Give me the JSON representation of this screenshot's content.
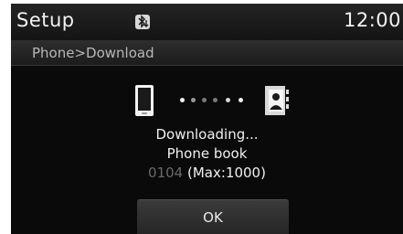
{
  "header": {
    "title": "Setup",
    "bluetooth_icon": "bluetooth-download-icon",
    "clock": "12:00"
  },
  "breadcrumb": "Phone>Download",
  "transfer": {
    "source_icon": "phone-icon",
    "target_icon": "contacts-book-icon",
    "progress_icon": "progress-dots",
    "status": "Downloading...",
    "item": "Phone book",
    "count": "0104",
    "max": "(Max:1000)"
  },
  "ok_label": "OK",
  "colors": {
    "background": "#0a0a0a",
    "text": "#f0f0f0",
    "count_text": "#6a6a6a"
  }
}
